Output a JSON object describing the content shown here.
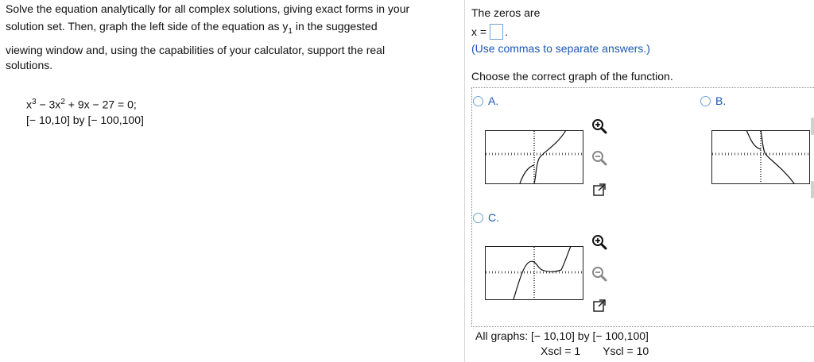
{
  "question": {
    "lines": [
      "Solve the equation analytically for all complex solutions, giving exact forms in your",
      "solution set. Then, graph the left side of the equation as y",
      "viewing window and, using the capabilities of your calculator, support the real",
      "solutions."
    ],
    "line2_sub": "1",
    "line2_tail": " in the suggested",
    "equation": {
      "x": "x",
      "exp3": "3",
      "mid": " − 3x",
      "exp2": "2",
      "rest": " + 9x − 27 = 0;"
    },
    "window": "[− 10,10] by [− 100,100]"
  },
  "answer": {
    "zeros_label": "The zeros are",
    "x_label": "x =",
    "x_value": "",
    "period": ".",
    "hint": "(Use commas to separate answers.)"
  },
  "graph_choice": {
    "prompt": "Choose the correct graph of the function.",
    "options": [
      {
        "letter": "A."
      },
      {
        "letter": "B."
      },
      {
        "letter": "C."
      }
    ],
    "footer_window": "All graphs: [− 10,10] by [− 100,100]",
    "xscl": "Xscl = 1",
    "yscl": "Yscl = 10"
  },
  "tools": {
    "zoom_in": "zoom-in-icon",
    "zoom_out": "zoom-out-icon",
    "expand": "expand-icon"
  },
  "colors": {
    "accent": "#1a56b4",
    "box_border": "#6fa3dc"
  }
}
